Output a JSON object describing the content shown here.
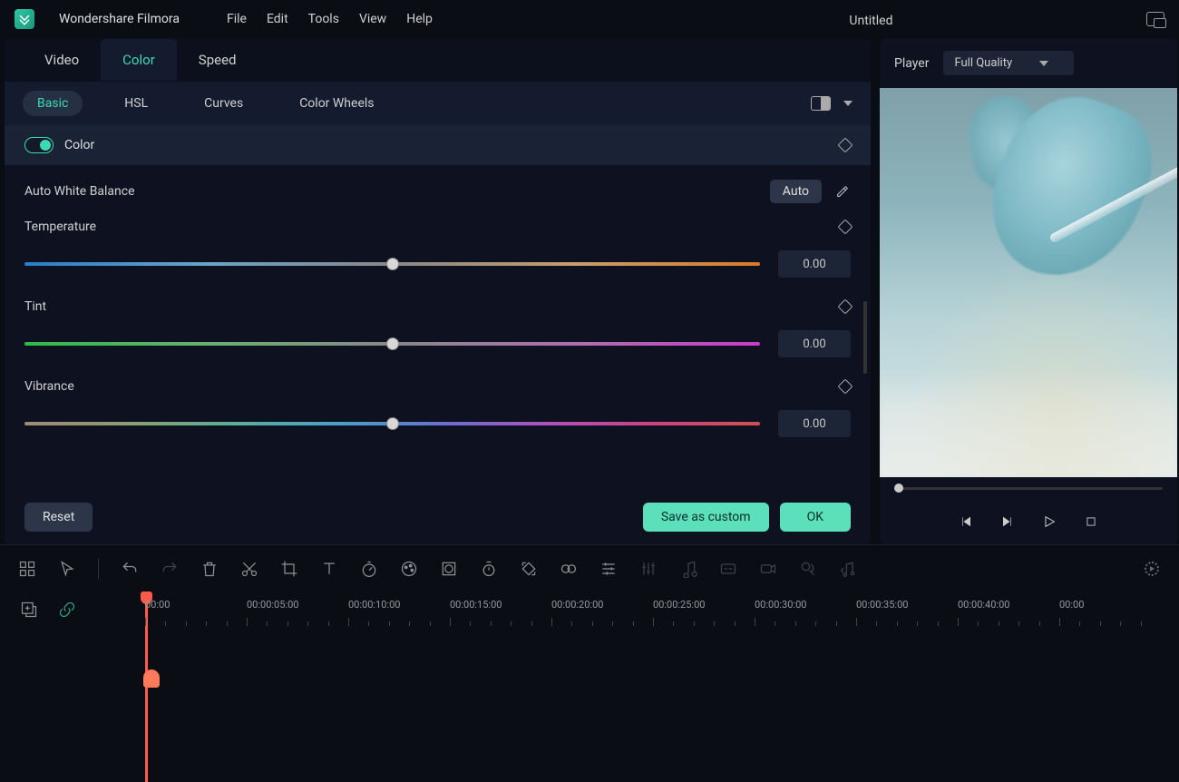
{
  "app": {
    "name": "Wondershare Filmora",
    "document": "Untitled"
  },
  "menus": [
    "File",
    "Edit",
    "Tools",
    "View",
    "Help"
  ],
  "top_tabs": {
    "items": [
      "Video",
      "Color",
      "Speed"
    ],
    "active": "Color"
  },
  "sub_tabs": {
    "items": [
      "Basic",
      "HSL",
      "Curves",
      "Color Wheels"
    ],
    "active": "Basic"
  },
  "section": {
    "title": "Color"
  },
  "awb": {
    "label": "Auto White Balance",
    "button": "Auto"
  },
  "sliders": [
    {
      "label": "Temperature",
      "value": "0.00",
      "track": "track-temp"
    },
    {
      "label": "Tint",
      "value": "0.00",
      "track": "track-tint"
    },
    {
      "label": "Vibrance",
      "value": "0.00",
      "track": "track-vibrance"
    }
  ],
  "footer": {
    "reset": "Reset",
    "save": "Save as custom",
    "ok": "OK"
  },
  "player": {
    "label": "Player",
    "quality": "Full Quality"
  },
  "timeline": {
    "ticks": [
      "00:00",
      "00:00:05:00",
      "00:00:10:00",
      "00:00:15:00",
      "00:00:20:00",
      "00:00:25:00",
      "00:00:30:00",
      "00:00:35:00",
      "00:00:40:00",
      "00:00"
    ]
  }
}
